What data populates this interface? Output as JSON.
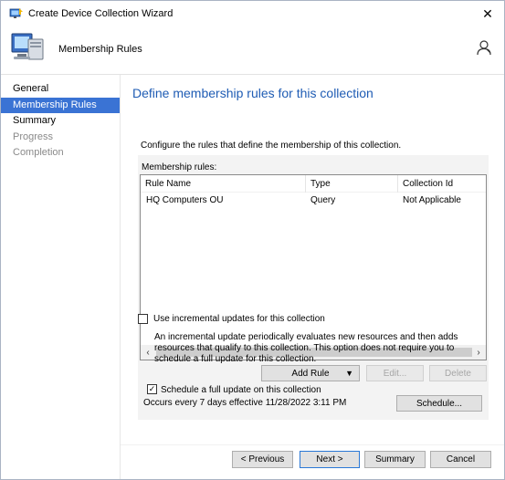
{
  "window": {
    "title": "Create Device Collection Wizard",
    "close_glyph": "✕"
  },
  "header": {
    "heading": "Membership Rules"
  },
  "sidebar": {
    "items": [
      {
        "label": "General",
        "state": "normal"
      },
      {
        "label": "Membership Rules",
        "state": "active"
      },
      {
        "label": "Summary",
        "state": "normal"
      },
      {
        "label": "Progress",
        "state": "disabled"
      },
      {
        "label": "Completion",
        "state": "disabled"
      }
    ]
  },
  "main": {
    "title": "Define membership rules for this collection",
    "description": "Configure the rules that define the membership of this collection.",
    "membership_rules_label": "Membership rules:",
    "table": {
      "columns": [
        "Rule Name",
        "Type",
        "Collection Id"
      ],
      "rows": [
        [
          "HQ Computers OU",
          "Query",
          "Not Applicable"
        ]
      ]
    },
    "buttons": {
      "add_rule": "Add Rule",
      "edit": "Edit...",
      "delete": "Delete"
    },
    "incremental": {
      "label": "Use incremental updates for this collection",
      "checked": false,
      "info": "An incremental update periodically evaluates new resources and then adds resources that qualify to this collection. This option does not require you to schedule a full update for this collection."
    },
    "full_update": {
      "label": "Schedule a full update on this collection",
      "checked": true,
      "check_glyph": "✓",
      "occurs": "Occurs every 7 days effective 11/28/2022 3:11 PM",
      "schedule_button": "Schedule..."
    }
  },
  "footer": {
    "previous": "< Previous",
    "next": "Next >",
    "summary": "Summary",
    "cancel": "Cancel"
  },
  "colors": {
    "accent": "#3a73d4",
    "title_blue": "#1f5cb4",
    "group_bg": "#f3f3f3"
  },
  "icons": {
    "app": "wizard-app-icon",
    "header": "computer-monitor-icon",
    "help": "help-person-icon",
    "scroll_left": "chevron-left-icon",
    "scroll_right": "chevron-right-icon",
    "dropdown": "triangle-down-icon"
  }
}
